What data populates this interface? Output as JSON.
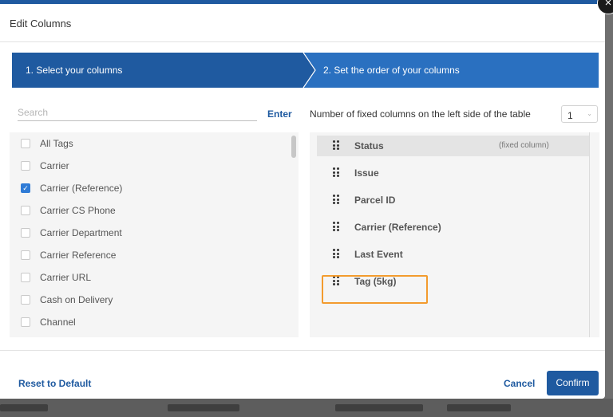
{
  "dialog": {
    "title": "Edit Columns",
    "close_icon": "×"
  },
  "stepper": {
    "steps": [
      {
        "label": "1. Select your columns",
        "active": true
      },
      {
        "label": "2. Set the order of your columns",
        "active": false
      }
    ]
  },
  "search": {
    "placeholder": "Search",
    "value": "",
    "enter_label": "Enter"
  },
  "tag_list": [
    {
      "label": "All Tags",
      "checked": false
    },
    {
      "label": "Carrier",
      "checked": false
    },
    {
      "label": "Carrier (Reference)",
      "checked": true
    },
    {
      "label": "Carrier CS Phone",
      "checked": false
    },
    {
      "label": "Carrier Department",
      "checked": false
    },
    {
      "label": "Carrier Reference",
      "checked": false
    },
    {
      "label": "Carrier URL",
      "checked": false
    },
    {
      "label": "Cash on Delivery",
      "checked": false
    },
    {
      "label": "Channel",
      "checked": false
    }
  ],
  "fixed_columns": {
    "label": "Number of fixed columns on the left side of the table",
    "value": "1"
  },
  "column_order": [
    {
      "label": "Status",
      "note": "(fixed column)",
      "fixed": true
    },
    {
      "label": "Issue",
      "note": "",
      "fixed": false
    },
    {
      "label": "Parcel ID",
      "note": "",
      "fixed": false
    },
    {
      "label": "Carrier (Reference)",
      "note": "",
      "fixed": false
    },
    {
      "label": "Last Event",
      "note": "",
      "fixed": false
    },
    {
      "label": "Tag (5kg)",
      "note": "",
      "fixed": false
    }
  ],
  "footer": {
    "reset_label": "Reset to Default",
    "cancel_label": "Cancel",
    "confirm_label": "Confirm"
  },
  "colors": {
    "primary": "#1f5aa0",
    "step_inactive": "#2a70c0",
    "highlight": "#f39b2e",
    "checkbox_checked": "#2f7bd6"
  }
}
